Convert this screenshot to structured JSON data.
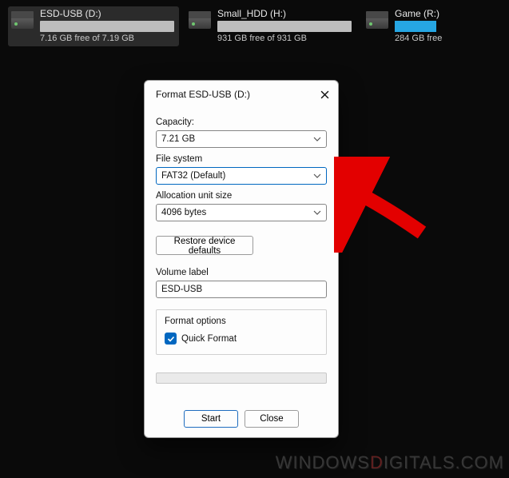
{
  "drives": [
    {
      "name": "ESD-USB (D:)",
      "free": "7.16 GB free of 7.19 GB",
      "fill_pct": 0
    },
    {
      "name": "Small_HDD (H:)",
      "free": "931 GB free of 931 GB",
      "fill_pct": 0
    },
    {
      "name": "Game (R:)",
      "free": "284 GB free",
      "fill_pct": 100
    }
  ],
  "dialog": {
    "title": "Format ESD-USB (D:)",
    "capacity_label": "Capacity:",
    "capacity_value": "7.21 GB",
    "fs_label": "File system",
    "fs_value": "FAT32 (Default)",
    "alloc_label": "Allocation unit size",
    "alloc_value": "4096 bytes",
    "restore_label": "Restore device defaults",
    "vol_label": "Volume label",
    "vol_value": "ESD-USB",
    "format_options_label": "Format options",
    "quick_format_label": "Quick Format",
    "quick_format_checked": true,
    "start_label": "Start",
    "close_label": "Close"
  },
  "watermark": {
    "prefix": "WINDOWS",
    "red": "D",
    "suffix": "IGITALS.COM"
  }
}
